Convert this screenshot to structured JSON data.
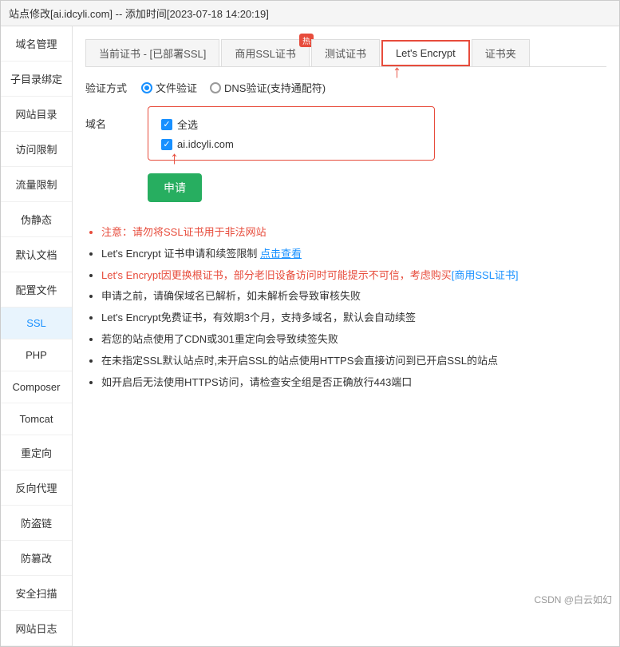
{
  "title_bar": {
    "text": "站点修改[ai.idcyli.com] -- 添加时间[2023-07-18 14:20:19]"
  },
  "sidebar": {
    "items": [
      {
        "label": "域名管理",
        "active": false
      },
      {
        "label": "子目录绑定",
        "active": false
      },
      {
        "label": "网站目录",
        "active": false
      },
      {
        "label": "访问限制",
        "active": false
      },
      {
        "label": "流量限制",
        "active": false
      },
      {
        "label": "伪静态",
        "active": false
      },
      {
        "label": "默认文档",
        "active": false
      },
      {
        "label": "配置文件",
        "active": false
      },
      {
        "label": "SSL",
        "active": true
      },
      {
        "label": "PHP",
        "active": false
      },
      {
        "label": "Composer",
        "active": false
      },
      {
        "label": "Tomcat",
        "active": false
      },
      {
        "label": "重定向",
        "active": false
      },
      {
        "label": "反向代理",
        "active": false
      },
      {
        "label": "防盗链",
        "active": false
      },
      {
        "label": "防篡改",
        "active": false
      },
      {
        "label": "安全扫描",
        "active": false
      },
      {
        "label": "网站日志",
        "active": false
      }
    ]
  },
  "tabs": [
    {
      "label": "当前证书 - [已部署SSL]",
      "active": false,
      "badge": null,
      "highlight": false
    },
    {
      "label": "商用SSL证书",
      "active": false,
      "badge": "热",
      "highlight": false
    },
    {
      "label": "测试证书",
      "active": false,
      "badge": null,
      "highlight": false
    },
    {
      "label": "Let's Encrypt",
      "active": true,
      "badge": null,
      "highlight": true
    },
    {
      "label": "证书夹",
      "active": false,
      "badge": null,
      "highlight": false
    }
  ],
  "form": {
    "verify_label": "验证方式",
    "verify_options": [
      {
        "label": "文件验证",
        "checked": true
      },
      {
        "label": "DNS验证(支持通配符)",
        "checked": false
      }
    ],
    "domain_label": "域名",
    "domain_select_all": "全选",
    "domain_item": "ai.idcyli.com",
    "submit_label": "申请"
  },
  "notes": [
    {
      "text": "注意：请勿将SSL证书用于非法网站",
      "type": "red"
    },
    {
      "text_parts": [
        {
          "text": "Let's Encrypt 证书申请和续签限制 ",
          "type": "normal"
        },
        {
          "text": "点击查看",
          "type": "link"
        }
      ],
      "type": "mixed"
    },
    {
      "text_parts": [
        {
          "text": "Let's Encrypt因更换根证书，部分老旧设备访问时可能提示不可信，考虑购买",
          "type": "red"
        },
        {
          "text": "[商用SSL证书]",
          "type": "bracket-link"
        }
      ],
      "type": "mixed-red"
    },
    {
      "text": "申请之前，请确保域名已解析，如未解析会导致审核失败",
      "type": "normal"
    },
    {
      "text": "Let's Encrypt免费证书，有效期3个月，支持多域名，默认会自动续签",
      "type": "normal"
    },
    {
      "text": "若您的站点使用了CDN或301重定向会导致续签失败",
      "type": "normal"
    },
    {
      "text": "在未指定SSL默认站点时,未开启SSL的站点使用HTTPS会直接访问到已开启SSL的站点",
      "type": "normal"
    },
    {
      "text": "如开启后无法使用HTTPS访问，请检查安全组是否正确放行443端口",
      "type": "normal"
    }
  ],
  "watermark": "CSDN @白云如幻"
}
